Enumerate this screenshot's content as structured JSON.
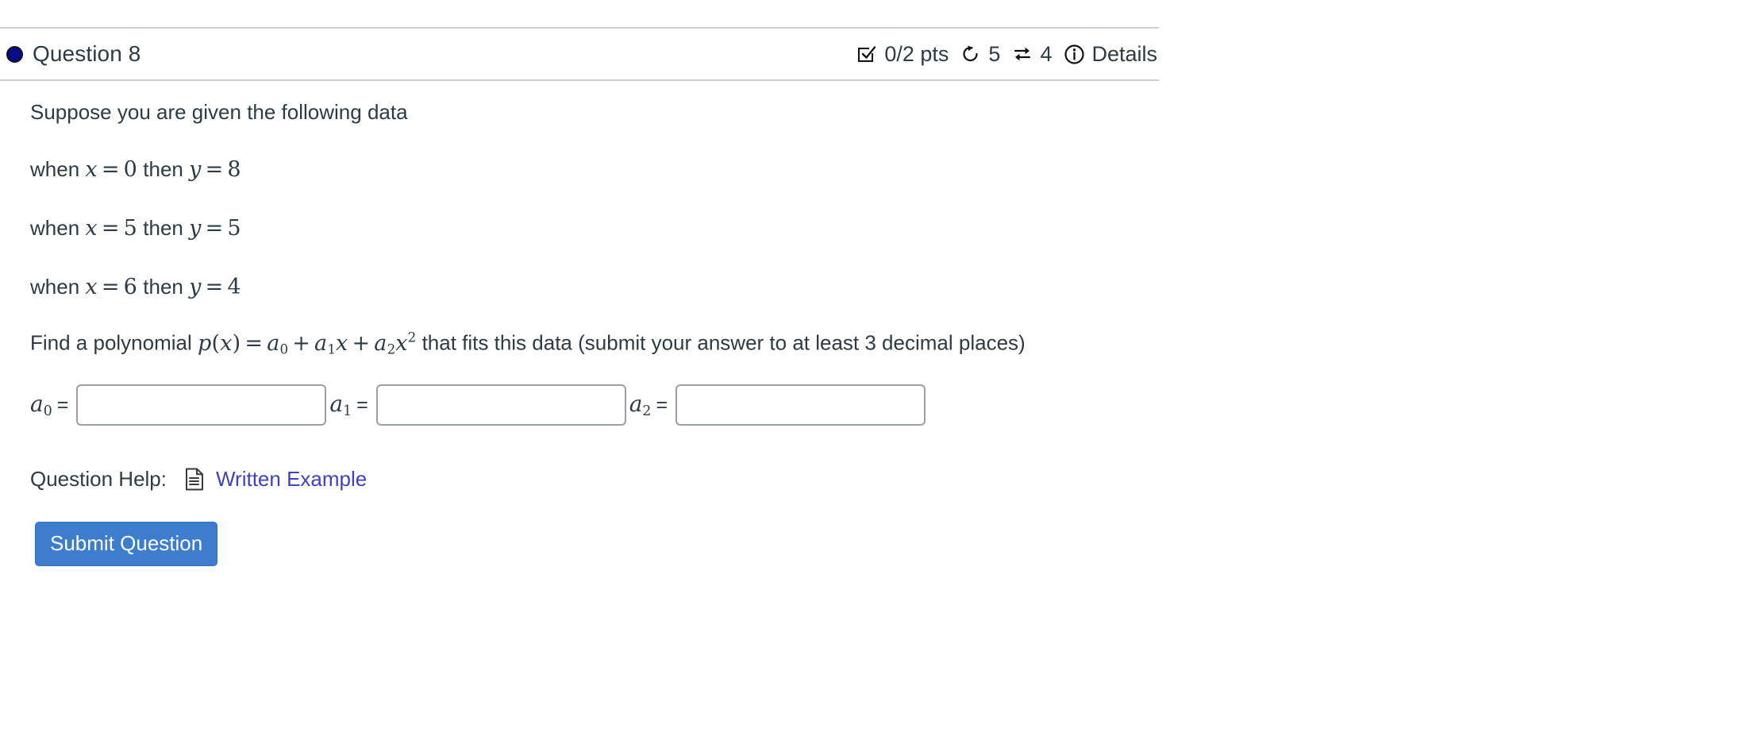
{
  "question": {
    "dot_color": "#0a0a8c",
    "title": "Question 8",
    "status": {
      "points": "0/2 pts",
      "points_icon": "checkbox-check-icon",
      "attempts": "5",
      "attempts_icon": "rotate-left-icon",
      "exchanges": "4",
      "exchanges_icon": "exchange-arrows-icon",
      "details_label": "Details",
      "details_icon": "info-circle-icon"
    },
    "body": {
      "intro": "Suppose you are given the following data",
      "data_points": [
        {
          "prefix": "when",
          "xvar": "x",
          "eq": "=",
          "xval": "0",
          "mid": "then",
          "yvar": "y",
          "eq2": "=",
          "yval": "8"
        },
        {
          "prefix": "when",
          "xvar": "x",
          "eq": "=",
          "xval": "5",
          "mid": "then",
          "yvar": "y",
          "eq2": "=",
          "yval": "5"
        },
        {
          "prefix": "when",
          "xvar": "x",
          "eq": "=",
          "xval": "6",
          "mid": "then",
          "yvar": "y",
          "eq2": "=",
          "yval": "4"
        }
      ],
      "prompt_lead": "Find a polynomial",
      "formula": {
        "p": "p",
        "lparen": "(",
        "x1": "x",
        "rparen": ")",
        "eq": "=",
        "a0": "a",
        "a0sub": "0",
        "plus1": "+",
        "a1": "a",
        "a1sub": "1",
        "x2": "x",
        "plus2": "+",
        "a2": "a",
        "a2sub": "2",
        "x3": "x",
        "sup": "2"
      },
      "prompt_tail": "that fits this data (submit your answer to at least 3 decimal places)"
    },
    "answers": [
      {
        "label": "a",
        "sub": "0",
        "eq": "=",
        "value": "",
        "placeholder": ""
      },
      {
        "label": "a",
        "sub": "1",
        "eq": "=",
        "value": "",
        "placeholder": ""
      },
      {
        "label": "a",
        "sub": "2",
        "eq": "=",
        "value": "",
        "placeholder": ""
      }
    ],
    "help": {
      "label": "Question Help:",
      "link_icon": "document-lines-icon",
      "link_text": "Written Example",
      "link_color": "#3e41c8"
    },
    "submit": {
      "label": "Submit Question",
      "color": "#3d7dce"
    }
  }
}
